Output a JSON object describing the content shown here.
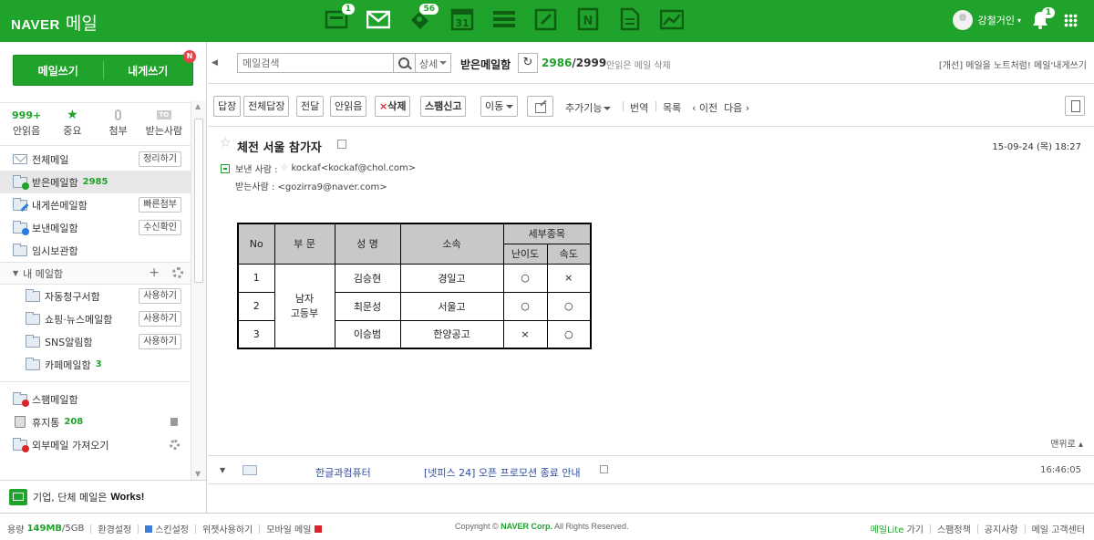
{
  "colors": {
    "brand": "#1fa32a",
    "link": "#2d4da0",
    "danger": "#d9252b"
  },
  "header": {
    "logo_brand": "NAVER",
    "logo_service": "메일",
    "apps": [
      {
        "icon": "memo-icon",
        "badge": "1"
      },
      {
        "icon": "mail-icon",
        "badge": ""
      },
      {
        "icon": "contacts-icon",
        "badge": "56"
      },
      {
        "icon": "calendar-icon",
        "badge": ""
      },
      {
        "icon": "list-icon",
        "badge": ""
      },
      {
        "icon": "note-icon",
        "badge": ""
      },
      {
        "icon": "n-drive-icon",
        "badge": ""
      },
      {
        "icon": "document-icon",
        "badge": ""
      },
      {
        "icon": "chart-icon",
        "badge": ""
      }
    ],
    "user_name": "강철거인",
    "bell_badge": "1"
  },
  "sidebar": {
    "compose_mail": "메일쓰기",
    "compose_self": "내게쓰기",
    "compose_badge": "N",
    "quick": [
      {
        "top": "999+",
        "label": "안읽음"
      },
      {
        "top": "star-icon",
        "label": "중요"
      },
      {
        "top": "clip-icon",
        "label": "첨부"
      },
      {
        "top": "TO",
        "label": "받는사람"
      }
    ],
    "folders": [
      {
        "label": "전체메일",
        "button": "정리하기"
      },
      {
        "label": "받은메일함",
        "count": "2985"
      },
      {
        "label": "내게쓴메일함",
        "button": "빠른첨부"
      },
      {
        "label": "보낸메일함",
        "button": "수신확인"
      },
      {
        "label": "임시보관함"
      }
    ],
    "my_section": "내 메일함",
    "my_folders": [
      {
        "label": "자동청구서함",
        "button": "사용하기"
      },
      {
        "label": "쇼핑·뉴스메일함",
        "button": "사용하기"
      },
      {
        "label": "SNS알림함",
        "button": "사용하기"
      },
      {
        "label": "카페메일함",
        "count": "3"
      }
    ],
    "extra_folders": [
      {
        "label": "스팸메일함"
      },
      {
        "label": "휴지통",
        "count": "208"
      },
      {
        "label": "외부메일 가져오기"
      }
    ],
    "works_text": "기업, 단체 메일은",
    "works_brand": "Works!"
  },
  "searchbar": {
    "placeholder": "메일검색",
    "detail": "상세",
    "box_title": "받은메일함",
    "unread": "2986",
    "total": "/2999",
    "delete_unread": "안읽은 메일 삭제",
    "promo": "[개선] 메일을 노트처럼! 메일'내게쓰기"
  },
  "toolbar": {
    "reply": "답장",
    "reply_all": "전체답장",
    "forward": "전달",
    "mark_unread": "안읽음",
    "delete_x": "×",
    "delete": "삭제",
    "spam": "스팸신고",
    "move": "이동",
    "more": "추가기능",
    "translate": "번역",
    "list": "목록",
    "prev": "‹ 이전",
    "next": "다음 ›"
  },
  "message": {
    "subject": "체전 서울 참가자",
    "date": "15-09-24 (목) 18:27",
    "from_label": "보낸 사람 :",
    "from": "kockaf<kockaf@chol.com>",
    "to_label": "받는사람 :",
    "to": "<gozirra9@naver.com>"
  },
  "table": {
    "headers": {
      "no": "No",
      "dept": "부 문",
      "name": "성 명",
      "org": "소속",
      "detail": "세부종목",
      "difficulty": "난이도",
      "speed": "속도"
    },
    "dept_value_1": "남자",
    "dept_value_2": "고등부",
    "rows": [
      {
        "no": "1",
        "name": "김승현",
        "org": "경일고",
        "difficulty": "○",
        "speed": "×"
      },
      {
        "no": "2",
        "name": "최문성",
        "org": "서울고",
        "difficulty": "○",
        "speed": "○"
      },
      {
        "no": "3",
        "name": "이승범",
        "org": "한양공고",
        "difficulty": "×",
        "speed": "○"
      }
    ]
  },
  "to_top": "맨위로 ▴",
  "next_mail": {
    "sender": "한글과컴퓨터",
    "subject": "[넷피스 24] 오픈 프로모션 종료 안내",
    "time": "16:46:05"
  },
  "footer": {
    "capacity_label": "용량",
    "capacity_used": "149MB",
    "capacity_total": "/5GB",
    "settings": "환경설정",
    "skin": "스킨설정",
    "widget": "위젯사용하기",
    "mobile": "모바일 메일",
    "copyright_prefix": "Copyright ©",
    "copyright_brand": "NAVER Corp.",
    "copyright_suffix": "All Rights Reserved.",
    "lite_brand": "메일Lite",
    "lite_go": "가기",
    "spam_policy": "스팸정책",
    "notice": "공지사항",
    "support": "메일 고객센터"
  }
}
